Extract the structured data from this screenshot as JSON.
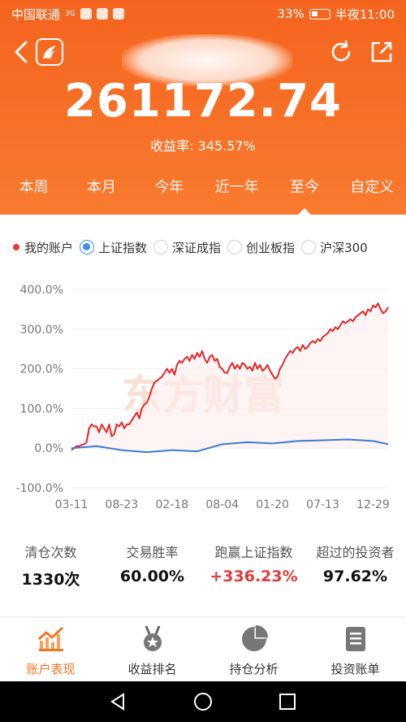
{
  "status_bar": {
    "carrier": "中国联通",
    "network": "3G",
    "battery": "33%",
    "time": "半夜11:00"
  },
  "header": {
    "total_value": "261172.74",
    "yield_label": "收益率:",
    "yield_value": "345.57%"
  },
  "tabs": [
    {
      "label": "本周"
    },
    {
      "label": "本月"
    },
    {
      "label": "今年"
    },
    {
      "label": "近一年"
    },
    {
      "label": "至今",
      "active": true
    },
    {
      "label": "自定义"
    }
  ],
  "legend": {
    "my_account": "我的账户",
    "options": [
      {
        "label": "上证指数",
        "checked": true
      },
      {
        "label": "深证成指",
        "checked": false
      },
      {
        "label": "创业板指",
        "checked": false
      },
      {
        "label": "沪深300",
        "checked": false
      }
    ]
  },
  "chart_data": {
    "type": "line",
    "x_ticks": [
      "03-11",
      "08-23",
      "02-18",
      "08-04",
      "01-20",
      "07-13",
      "12-29"
    ],
    "y_ticks": [
      "400.0%",
      "300.0%",
      "200.0%",
      "100.0%",
      "0.0%",
      "-100.0%"
    ],
    "ylim": [
      -100,
      400
    ],
    "watermark": "东方财富",
    "series": [
      {
        "name": "我的账户",
        "color": "#e02828",
        "x": [
          0,
          0.05,
          0.1,
          0.15,
          0.2,
          0.25,
          0.3,
          0.35,
          0.4,
          0.45,
          0.5,
          0.55,
          0.6,
          0.65,
          0.7,
          0.75,
          0.8,
          0.85,
          0.9,
          0.95,
          1.0,
          1.05,
          1.1,
          1.15,
          1.2,
          1.25,
          1.3,
          1.35,
          1.4,
          1.45,
          1.5,
          1.55,
          1.6,
          1.65,
          1.7,
          1.75,
          1.8,
          1.85,
          1.9,
          1.95,
          2.0,
          2.05,
          2.1,
          2.15,
          2.2,
          2.25,
          2.3,
          2.35,
          2.4,
          2.45,
          2.5,
          2.55,
          2.6,
          2.65,
          2.7,
          2.75,
          2.8,
          2.85,
          2.9,
          2.95,
          3.0,
          3.05,
          3.1,
          3.15,
          3.2,
          3.25,
          3.3,
          3.35,
          3.4,
          3.45,
          3.5,
          3.55,
          3.6,
          3.65,
          3.7,
          3.75,
          3.8,
          3.85,
          3.9,
          3.95,
          4.0,
          4.05,
          4.1,
          4.15,
          4.2,
          4.25,
          4.3,
          4.35,
          4.4,
          4.45,
          4.5,
          4.55,
          4.6,
          4.65,
          4.7,
          4.75,
          4.8,
          4.85,
          4.9,
          4.95,
          5.0,
          5.05,
          5.1,
          5.15,
          5.2,
          5.25,
          5.3,
          5.35,
          5.4,
          5.45,
          5.5,
          5.55,
          5.6,
          5.65,
          5.7,
          5.75,
          5.8,
          5.85,
          5.9,
          5.95,
          6.0,
          6.05,
          6.1,
          6.15,
          6.2,
          6.25,
          6.3
        ],
        "values": [
          -5,
          0,
          5,
          5,
          8,
          10,
          15,
          50,
          60,
          55,
          55,
          40,
          60,
          50,
          40,
          60,
          30,
          35,
          60,
          55,
          65,
          50,
          60,
          60,
          70,
          80,
          90,
          75,
          100,
          110,
          115,
          130,
          150,
          165,
          170,
          175,
          180,
          190,
          200,
          190,
          200,
          185,
          210,
          220,
          215,
          225,
          230,
          220,
          235,
          225,
          240,
          230,
          245,
          225,
          215,
          230,
          235,
          220,
          225,
          205,
          200,
          190,
          190,
          205,
          215,
          200,
          210,
          200,
          215,
          210,
          200,
          205,
          195,
          215,
          200,
          210,
          195,
          200,
          210,
          195,
          185,
          175,
          180,
          200,
          210,
          225,
          235,
          245,
          240,
          250,
          255,
          245,
          260,
          250,
          255,
          265,
          270,
          265,
          275,
          270,
          280,
          285,
          290,
          300,
          295,
          305,
          300,
          310,
          320,
          315,
          320,
          325,
          320,
          330,
          335,
          340,
          345,
          335,
          350,
          345,
          360,
          355,
          365,
          350,
          340,
          345,
          355
        ]
      },
      {
        "name": "上证指数",
        "color": "#3b7ad8",
        "x": [
          0,
          0.5,
          1.0,
          1.5,
          2.0,
          2.5,
          3.0,
          3.5,
          4.0,
          4.5,
          5.0,
          5.5,
          6.0,
          6.3
        ],
        "values": [
          0,
          5,
          -5,
          -10,
          -5,
          -8,
          10,
          15,
          12,
          18,
          20,
          22,
          18,
          10
        ]
      }
    ]
  },
  "stats": [
    {
      "label": "清仓次数",
      "value": "1330次"
    },
    {
      "label": "交易胜率",
      "value": "60.00%"
    },
    {
      "label": "跑赢上证指数",
      "value": "+336.23%",
      "up": true
    },
    {
      "label": "超过的投资者",
      "value": "97.62%"
    }
  ],
  "bottom_nav": [
    {
      "label": "账户表现",
      "icon": "chart-trend-icon",
      "active": true
    },
    {
      "label": "收益排名",
      "icon": "medal-icon"
    },
    {
      "label": "持仓分析",
      "icon": "pie-chart-icon"
    },
    {
      "label": "投资账单",
      "icon": "bill-icon"
    }
  ]
}
